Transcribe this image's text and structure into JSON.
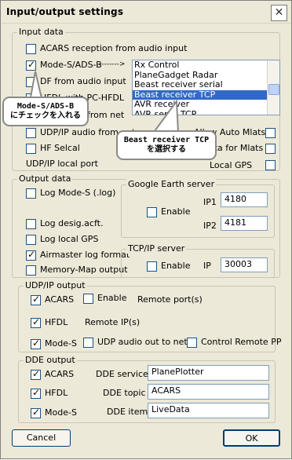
{
  "window": {
    "title": "Input/output settings",
    "close_glyph": "✕"
  },
  "input_data": {
    "legend": "Input data",
    "acars_audio": "ACARS reception from audio input",
    "mode_s": "Mode-S/ADS-B",
    "arrow": "-------->",
    "df_audio": "DF from audio input",
    "hfdl_pc": "HFDL with PC-HFDL",
    "from_net": "from net",
    "udp_audio": "UDP/IP audio from net",
    "auto_mlats": "Allow Auto Mlats",
    "hf_selcal": "HF Selcal",
    "data_mlats": "data for Mlats",
    "udp_local_port": "UDP/IP local port",
    "local_gps": "Local GPS",
    "list_items": [
      "Rx Control",
      "PlaneGadget Radar",
      "Beast receiver serial",
      "Beast receiver TCP",
      "AVR receiver",
      "AVR serial TCP"
    ],
    "selected_index": 3
  },
  "output_data": {
    "legend": "Output data",
    "log_modes": "Log Mode-S (.log)",
    "log_desig": "Log desig.acft.",
    "log_gps": "Log local GPS",
    "airmaster": "Airmaster log format",
    "memory_map": "Memory-Map output",
    "google_earth": {
      "legend": "Google Earth server",
      "enable": "Enable",
      "ip1_label": "IP1",
      "ip1_value": "4180",
      "ip2_label": "IP2",
      "ip2_value": "4181"
    },
    "tcp_server": {
      "legend": "TCP/IP server",
      "enable": "Enable",
      "ip_label": "IP",
      "ip_value": "30003"
    }
  },
  "udp_output": {
    "legend": "UDP/IP output",
    "acars": "ACARS",
    "enable": "Enable",
    "remote_ports": "Remote port(s)",
    "hfdl": "HFDL",
    "remote_ips": "Remote IP(s)",
    "modes": "Mode-S",
    "udp_audio_out": "UDP audio out to net",
    "control_remote": "Control Remote PP"
  },
  "dde_output": {
    "legend": "DDE output",
    "acars": "ACARS",
    "hfdl": "HFDL",
    "modes": "Mode-S",
    "service_label": "DDE service",
    "service_value": "PlanePlotter",
    "topic_label": "DDE topic",
    "topic_value": "ACARS",
    "item_label": "DDE item",
    "item_value": "LiveData"
  },
  "buttons": {
    "cancel": "Cancel",
    "ok": "OK"
  },
  "annotations": {
    "callout1_line1": "Mode-S/ADS-B",
    "callout1_line2": "にチェックを入れる",
    "callout2_line1": "Beast receiver TCP",
    "callout2_line2": "を選択する"
  }
}
